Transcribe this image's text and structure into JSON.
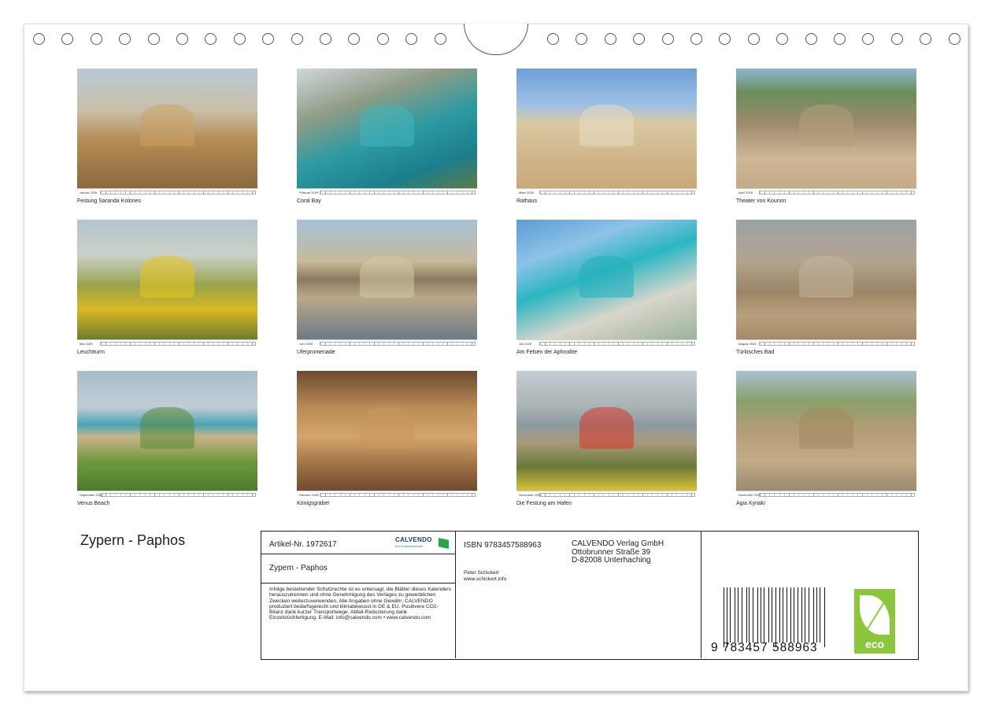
{
  "tiles": [
    {
      "month": "Januar 2026",
      "caption": "Festung Saranda Kolones",
      "bg": "linear-gradient(180deg,#b9c9d6 0%,#c9bfa8 35%,#b48c55 60%,#8b6a3e 100%)",
      "accent": "#caa266"
    },
    {
      "month": "Februar 2026",
      "caption": "Coral Bay",
      "bg": "linear-gradient(160deg,#cfd8dc 0%,#8e9c86 30%,#2d9aa2 55%,#1d7e8b 80%,#5b7b4a 100%)",
      "accent": "#3fb6be"
    },
    {
      "month": "März 2026",
      "caption": "Rathaus",
      "bg": "linear-gradient(180deg,#6f9fd6 0%,#9ec0e6 30%,#d9c9a3 45%,#d1b58a 75%,#c8a878 100%)",
      "accent": "#e8dcc2"
    },
    {
      "month": "April 2026",
      "caption": "Theater von Kourion",
      "bg": "linear-gradient(180deg,#8fb5d2 0%,#6a8e5a 20%,#9c8a6c 45%,#cdb796 75%,#c4ab86 100%)",
      "accent": "#b49e7a"
    },
    {
      "month": "Mai 2026",
      "caption": "Leuchtturm",
      "bg": "linear-gradient(180deg,#b5c4cc 0%,#c9d0c7 30%,#9aa34a 55%,#d8b925 75%,#6f7b2b 100%)",
      "accent": "#e8c51e"
    },
    {
      "month": "Juni 2026",
      "caption": "Uferpromenade",
      "bg": "linear-gradient(180deg,#a6c1d8 0%,#c7b99a 35%,#8c7a5e 50%,#b9a98a 65%,#6d7a86 100%)",
      "accent": "#d6c6a8"
    },
    {
      "month": "Juli 2026",
      "caption": "Am Felsen der Aphrodite",
      "bg": "linear-gradient(160deg,#5c9bd4 0%,#8dc3e8 25%,#2bb6c2 45%,#d9d6cc 70%,#9bb29a 100%)",
      "accent": "#24aebc"
    },
    {
      "month": "August 2026",
      "caption": "Türkisches Bad",
      "bg": "linear-gradient(180deg,#9aa2a6 0%,#b3a48e 35%,#9b8566 60%,#b8a07c 80%,#a38b69 100%)",
      "accent": "#c3b29a"
    },
    {
      "month": "September 2026",
      "caption": "Venus Beach",
      "bg": "linear-gradient(180deg,#a9bccb 0%,#c1cdd6 30%,#4aa3b2 45%,#c9b48a 55%,#6f9a3f 75%,#4d7a2c 100%)",
      "accent": "#5a8a36"
    },
    {
      "month": "Oktober 2026",
      "caption": "Königsgräber",
      "bg": "linear-gradient(180deg,#6b4a2e 0%,#b98b56 30%,#d4a46c 55%,#9d6f43 80%,#6e4c30 100%)",
      "accent": "#c89660"
    },
    {
      "month": "November 2026",
      "caption": "Die Festung am Hafen",
      "bg": "linear-gradient(180deg,#c3cdd3 0%,#a9b3b4 30%,#8c9aa0 45%,#a89a7a 60%,#6a7a3a 80%,#d9c238 100%)",
      "accent": "#d8352a"
    },
    {
      "month": "Dezember 2026",
      "caption": "Agia Kyriaki",
      "bg": "linear-gradient(180deg,#a9c0d2 0%,#8aa06a 25%,#b49c76 50%,#c2ab86 75%,#9a8a70 100%)",
      "accent": "#a48962"
    }
  ],
  "cover_title": "Zypern - Paphos",
  "info": {
    "article": "Artikel-Nr. 1972617",
    "logo_text": "CALVENDO",
    "logo_sub": "Ihre Kalendermarke",
    "title": "Zypern - Paphos",
    "legal": "Infolge bestehender Schutzrechte ist es untersagt, die Blätter dieses Kalenders herauszutrennen und ohne Genehmigung des Verlages zu gewerblichen Zwecken weiterzuverwenden. Alle Angaben ohne Gewähr. CALVENDO produziert bedarfsgerecht und klimabewusst in DE & EU. Positivere CO2-Bilanz dank kurzer Transportwege. Abfall-Reduzierung dank Einzelstückfertigung. E-Mail: info@calvendo.com • www.calvendo.com",
    "isbn": "ISBN 9783457588963",
    "publisher_1": "CALVENDO Verlag GmbH",
    "publisher_2": "Ottobrunner Straße 39",
    "publisher_3": "D-82008 Unterhaching",
    "author_name": "Peter Schickert",
    "author_web": "www.schickert.info",
    "barcode_number": "9 783457 588963",
    "eco_label": "eco"
  }
}
